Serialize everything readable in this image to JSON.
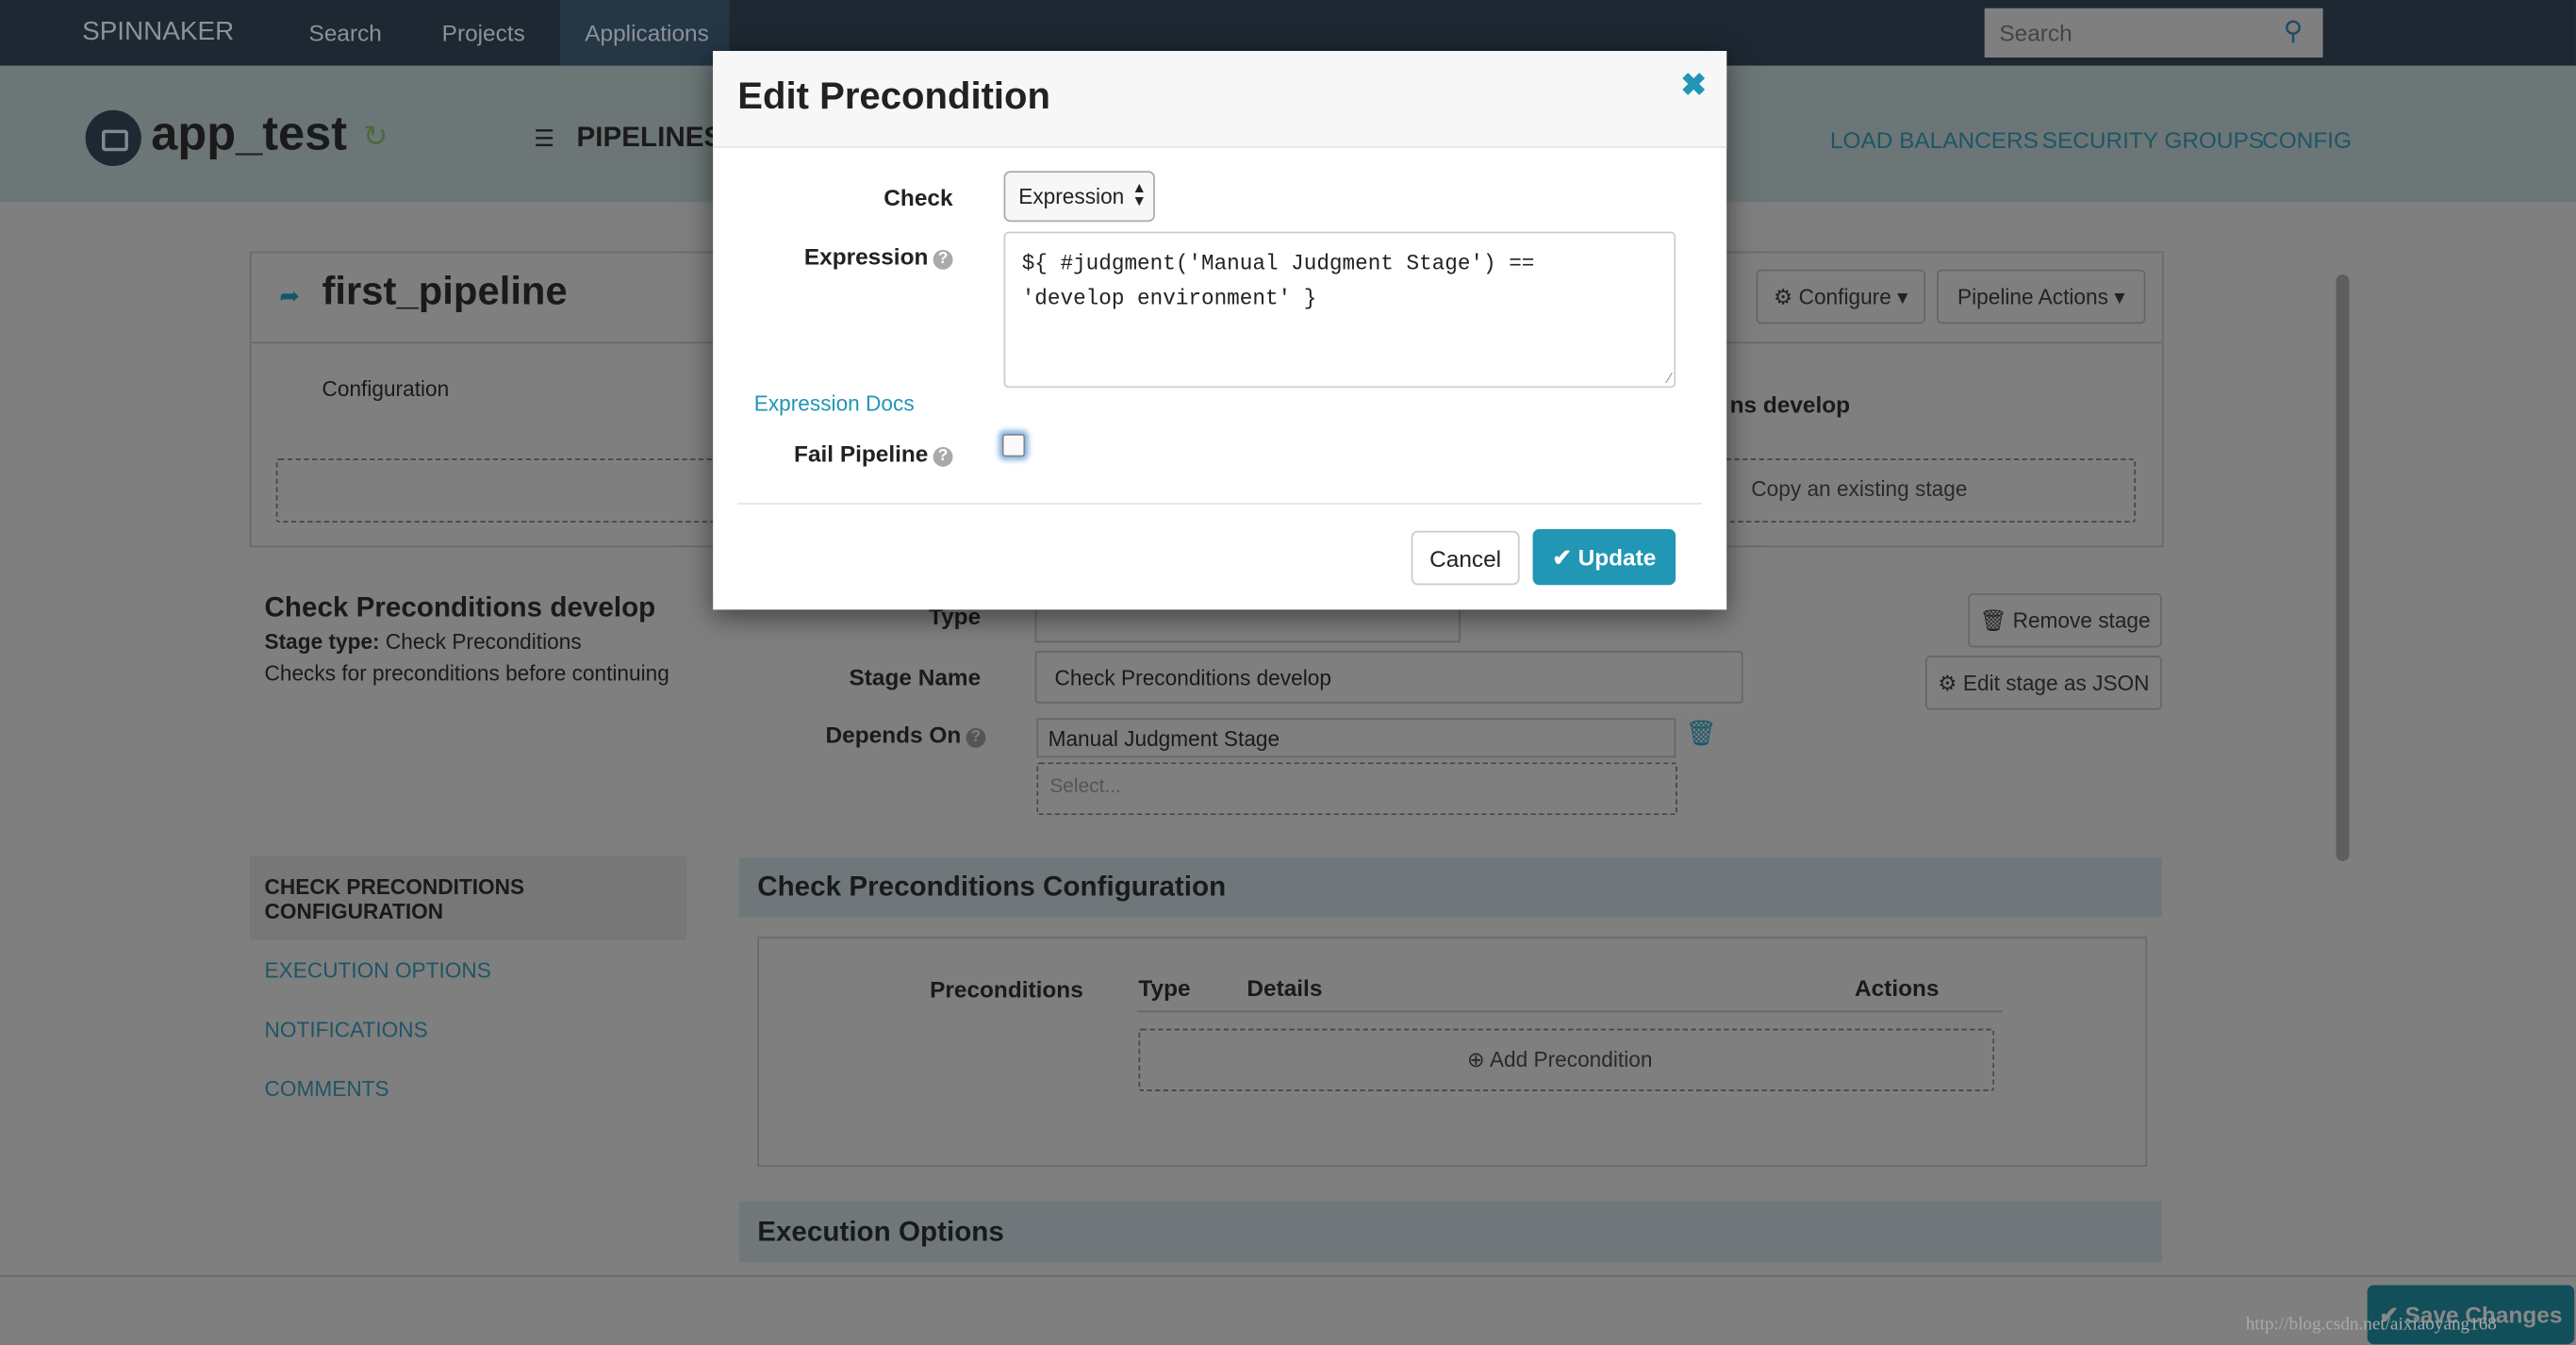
{
  "nav": {
    "brand": "SPINNAKER",
    "links": [
      "Search",
      "Projects",
      "Applications"
    ],
    "search_placeholder": "Search"
  },
  "app": {
    "name": "app_test",
    "tab": "PIPELINES",
    "right_tabs": [
      "LOAD BALANCERS",
      "SECURITY GROUPS",
      "CONFIG"
    ]
  },
  "pipeline": {
    "name": "first_pipeline",
    "configure": "Configure",
    "actions": "Pipeline Actions",
    "config_label": "Configuration",
    "stage_partial": "ns develop",
    "copy_stage": "Copy an existing stage"
  },
  "stage": {
    "title": "Check Preconditions develop",
    "type_label": "Stage type:",
    "type_value": "Check Preconditions",
    "description": "Checks for preconditions before continuing",
    "type_field_label": "Type",
    "name_label": "Stage Name",
    "name_value": "Check Preconditions develop",
    "depends_label": "Depends On",
    "depends_value": "Manual Judgment Stage",
    "depends_placeholder": "Select...",
    "remove": "Remove stage",
    "edit_json": "Edit stage as JSON"
  },
  "side_nav": [
    "CHECK PRECONDITIONS CONFIGURATION",
    "EXECUTION OPTIONS",
    "NOTIFICATIONS",
    "COMMENTS"
  ],
  "config_section": {
    "title": "Check Preconditions Configuration",
    "columns": [
      "Preconditions",
      "Type",
      "Details",
      "Actions"
    ],
    "add": "Add Precondition"
  },
  "exec_section": {
    "title": "Execution Options"
  },
  "save": "Save Changes",
  "watermark": "http://blog.csdn.net/aixiaoyang168",
  "modal": {
    "title": "Edit Precondition",
    "check_label": "Check",
    "check_value": "Expression",
    "expression_label": "Expression",
    "expression_value": "${ #judgment('Manual Judgment Stage') ==\n'develop environment' }",
    "docs": "Expression Docs",
    "fail_label": "Fail Pipeline",
    "fail_checked": false,
    "cancel": "Cancel",
    "update": "Update"
  },
  "colors": {
    "accent": "#2196b5",
    "nav": "#1d2833"
  }
}
